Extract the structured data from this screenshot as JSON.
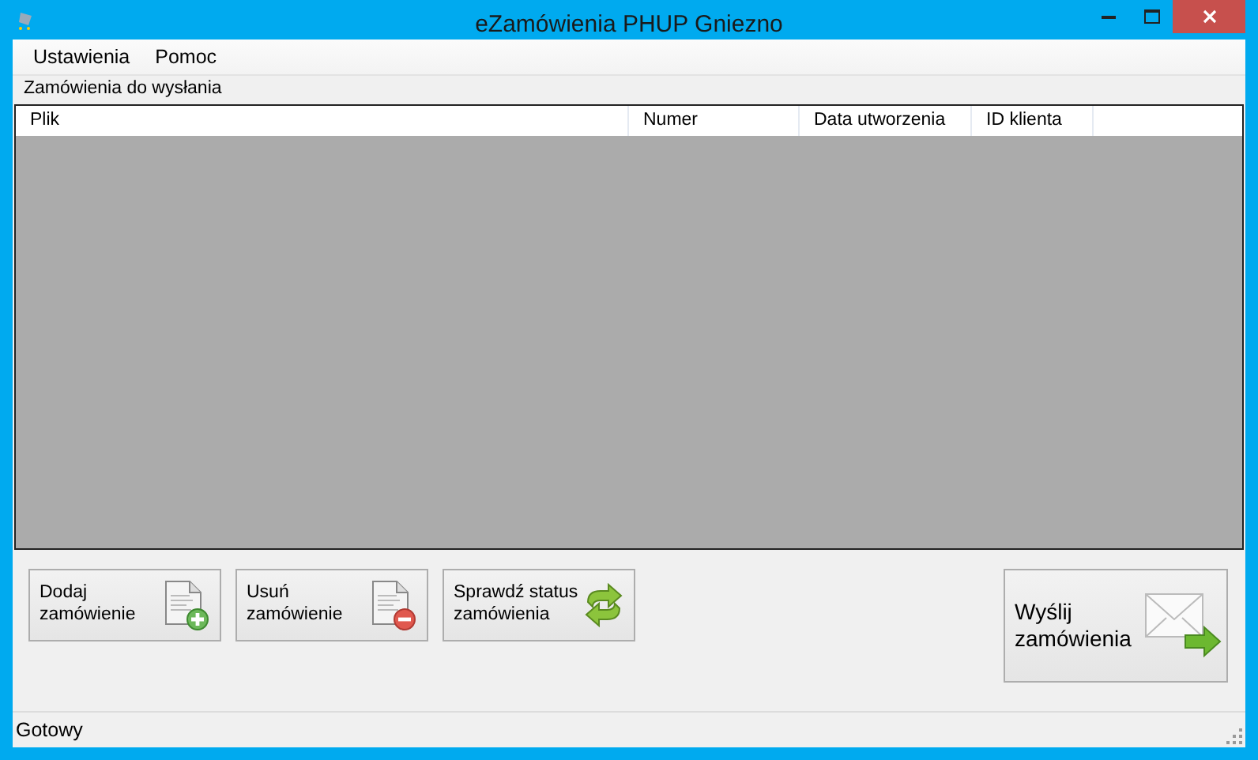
{
  "window": {
    "title": "eZamówienia PHUP Gniezno"
  },
  "menu": [
    "Ustawienia",
    "Pomoc"
  ],
  "group": {
    "label": "Zamówienia do wysłania"
  },
  "table": {
    "columns": [
      "Plik",
      "Numer",
      "Data utworzenia",
      "ID klienta"
    ]
  },
  "buttons": [
    {
      "label": "Dodaj\nzamówienie",
      "kind": "add"
    },
    {
      "label": "Usuń\nzamówienie",
      "kind": "remove"
    },
    {
      "label": "Sprawdź status\nzamówienia",
      "kind": "refresh"
    },
    {
      "label": "Wyślij\nzamówienia",
      "kind": "send"
    }
  ],
  "status_bar": "Gotowy"
}
